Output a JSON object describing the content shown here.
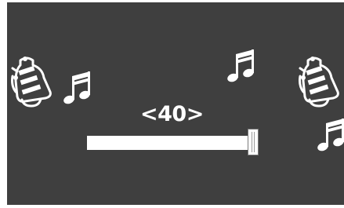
{
  "setting": {
    "value_display": "<40>",
    "value": 40,
    "level": 1.0
  },
  "icons": {
    "bell_left": "bell-icon",
    "bell_right": "bell-icon",
    "notes": "music-note-icon"
  },
  "colors": {
    "panel_background": "#3f3f3f",
    "foreground": "#ffffff",
    "thumb_border": "#7a7a7a"
  }
}
